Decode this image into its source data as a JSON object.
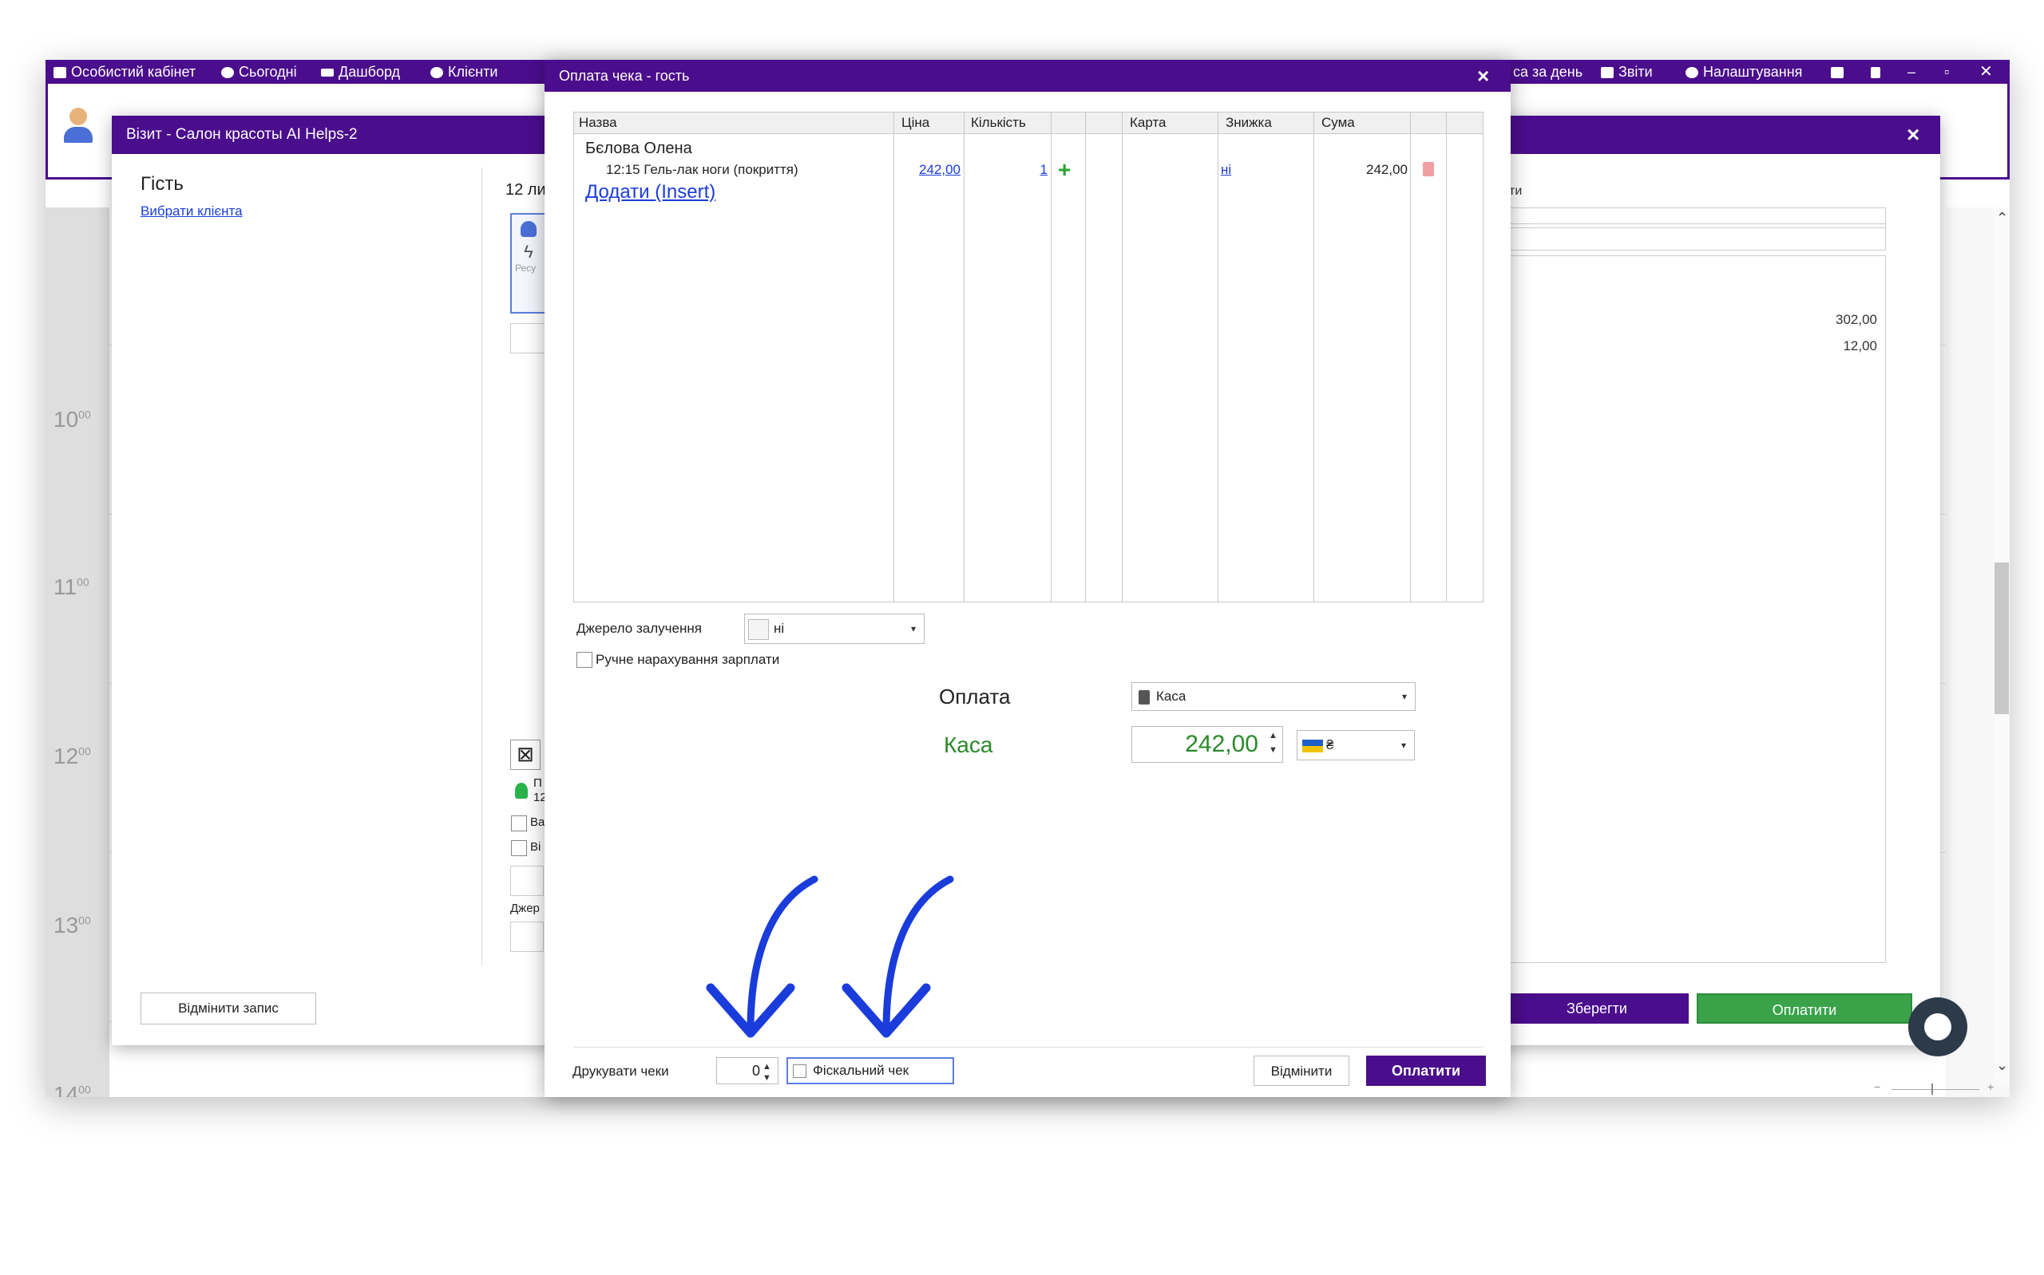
{
  "topbar": {
    "items": [
      "Особистий кабінет",
      "Сьогодні",
      "Дашборд",
      "Клієнти"
    ],
    "right_items": [
      "са за день",
      "Звіти",
      "Налаштування"
    ]
  },
  "calendar": {
    "hours": [
      "10",
      "11",
      "12",
      "13",
      "14"
    ],
    "minutes": "00"
  },
  "visit": {
    "title": "Візит - Салон красоты AI Helps-2",
    "guest": "Гість",
    "choose_client": "Вибрати клієнта",
    "date_fragment": "12 ли",
    "resource_fragment": "Ресу",
    "cancel_record": "Відмінити запис",
    "right_label_fragment": "ти",
    "right_values": [
      "302,00",
      "12,00"
    ],
    "save": "Зберегти",
    "pay": "Оплатити",
    "frag_p": "П",
    "frag_12": "12",
    "frag_ba": "Ва",
    "frag_bi": "Ві",
    "frag_dzher": "Джер"
  },
  "payment": {
    "title": "Оплата чека - гость",
    "columns": [
      "Назва",
      "Ціна",
      "Кількість",
      "Карта",
      "Знижка",
      "Сума"
    ],
    "client_name": "Бєлова Олена",
    "row": {
      "name": "12:15 Гель-лак ноги (покриття)",
      "price": "242,00",
      "qty": "1",
      "discount": "ні",
      "sum": "242,00"
    },
    "add_link": "Додати (Insert)",
    "source_label": "Джерело залучення",
    "source_value": "ні",
    "manual_salary": "Ручне нарахування зарплати",
    "payment_label": "Оплата",
    "payment_method": "Каса",
    "kasa_label": "Каса",
    "amount": "242,00",
    "currency": "₴",
    "print_label": "Друкувати чеки",
    "print_count": "0",
    "fiscal": "Фіскальний чек",
    "cancel": "Відмінити",
    "pay": "Оплатити"
  },
  "colors": {
    "brand": "#4a0d8c",
    "pay_green": "#3aa34a",
    "amount_green": "#2a8a2a",
    "link": "#1a3cdb",
    "annotation_arrow": "#1a3cdb"
  }
}
